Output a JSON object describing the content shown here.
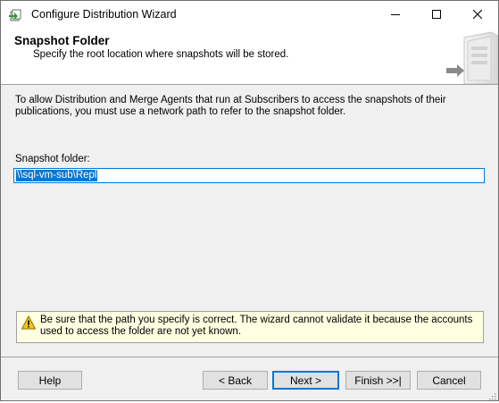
{
  "window": {
    "title": "Configure Distribution Wizard",
    "controls": [
      "minimize-icon",
      "maximize-icon",
      "close-icon"
    ]
  },
  "header": {
    "heading": "Snapshot Folder",
    "subheading": "Specify the root location where snapshots will be stored."
  },
  "content": {
    "intro": "To allow Distribution and Merge Agents that run at Subscribers to access the snapshots of their publications, you must use a network path to refer to the snapshot folder.",
    "folder_label": "Snapshot folder:",
    "folder_value": "\\\\sql-vm-sub\\Repl",
    "warning": "Be sure that the path you specify is correct. The wizard cannot validate it because the accounts used to access the folder are not yet known."
  },
  "footer": {
    "help": "Help",
    "back": "< Back",
    "next": "Next >",
    "finish": "Finish >>|",
    "cancel": "Cancel"
  },
  "colors": {
    "accent": "#0078d7",
    "warning_bg": "#ffffe1",
    "dialog_bg": "#f0f0f0"
  }
}
